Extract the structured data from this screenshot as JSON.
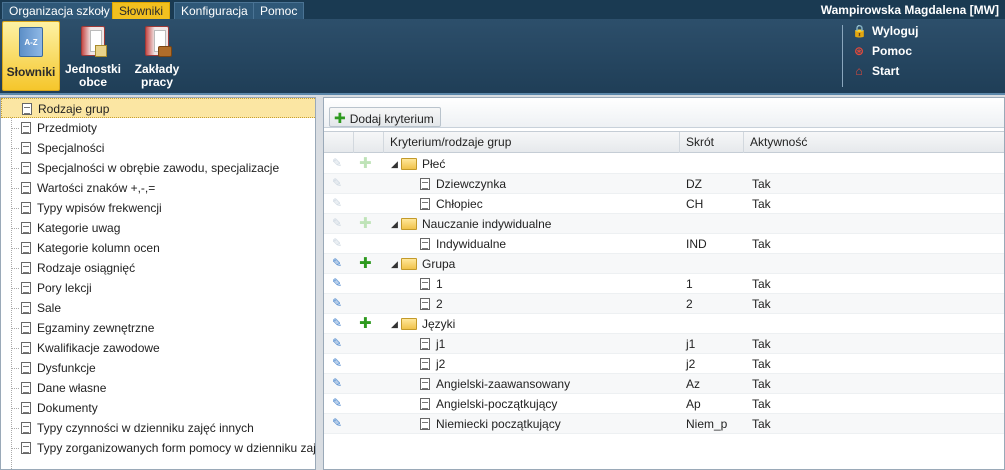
{
  "menu": {
    "tabs": [
      {
        "label": "Organizacja szkoły",
        "active": false
      },
      {
        "label": "Słowniki",
        "active": true
      },
      {
        "label": "Konfiguracja",
        "active": false
      },
      {
        "label": "Pomoc",
        "active": false
      }
    ],
    "user": "Wampirowska Magdalena [MW]"
  },
  "ribbon": {
    "buttons": [
      {
        "label": "Słowniki",
        "icon": "dictionary-az-icon",
        "active": true
      },
      {
        "label": "Jednostki obce",
        "icon": "foreign-units-icon",
        "active": false
      },
      {
        "label": "Zakłady pracy",
        "icon": "workplaces-icon",
        "active": false
      }
    ],
    "links": [
      {
        "label": "Wyloguj",
        "icon": "lock-icon"
      },
      {
        "label": "Pomoc",
        "icon": "lifebuoy-icon"
      },
      {
        "label": "Start",
        "icon": "home-icon"
      }
    ]
  },
  "tree": {
    "items": [
      "Rodzaje grup",
      "Przedmioty",
      "Specjalności",
      "Specjalności w obrębie zawodu, specjalizacje",
      "Wartości znaków +,-,=",
      "Typy wpisów frekwencji",
      "Kategorie uwag",
      "Kategorie kolumn ocen",
      "Rodzaje osiągnięć",
      "Pory lekcji",
      "Sale",
      "Egzaminy zewnętrzne",
      "Kwalifikacje zawodowe",
      "Dysfunkcje",
      "Dane własne",
      "Dokumenty",
      "Typy czynności w dzienniku zajęć innych",
      "Typy zorganizowanych form pomocy w dzienniku zajęć innych"
    ],
    "selected_index": 0
  },
  "toolbar": {
    "add_label": "Dodaj kryterium"
  },
  "grid": {
    "columns": [
      "Kryterium/rodzaje grup",
      "Skrót",
      "Aktywność"
    ],
    "rows": [
      {
        "level": 0,
        "name": "Płeć",
        "short": "",
        "active": "",
        "editable": false
      },
      {
        "level": 1,
        "name": "Dziewczynka",
        "short": "DZ",
        "active": "Tak",
        "editable": false
      },
      {
        "level": 1,
        "name": "Chłopiec",
        "short": "CH",
        "active": "Tak",
        "editable": false
      },
      {
        "level": 0,
        "name": "Nauczanie indywidualne",
        "short": "",
        "active": "",
        "editable": false
      },
      {
        "level": 1,
        "name": "Indywidualne",
        "short": "IND",
        "active": "Tak",
        "editable": false
      },
      {
        "level": 0,
        "name": "Grupa",
        "short": "",
        "active": "",
        "editable": true
      },
      {
        "level": 1,
        "name": "1",
        "short": "1",
        "active": "Tak",
        "editable": true
      },
      {
        "level": 1,
        "name": "2",
        "short": "2",
        "active": "Tak",
        "editable": true
      },
      {
        "level": 0,
        "name": "Języki",
        "short": "",
        "active": "",
        "editable": true
      },
      {
        "level": 1,
        "name": "j1",
        "short": "j1",
        "active": "Tak",
        "editable": true
      },
      {
        "level": 1,
        "name": "j2",
        "short": "j2",
        "active": "Tak",
        "editable": true
      },
      {
        "level": 1,
        "name": "Angielski-zaawansowany",
        "short": "Az",
        "active": "Tak",
        "editable": true
      },
      {
        "level": 1,
        "name": "Angielski-początkujący",
        "short": "Ap",
        "active": "Tak",
        "editable": true
      },
      {
        "level": 1,
        "name": "Niemiecki początkujący",
        "short": "Niem_p",
        "active": "Tak",
        "editable": true
      }
    ]
  },
  "colors": {
    "menubar": "#1a3a52",
    "active_tab": "#f2c01f",
    "ribbon": "#2d4f6b",
    "selection": "#fbe6a3",
    "add_green": "#2e9a1f",
    "edit_blue": "#3a7bc8"
  }
}
